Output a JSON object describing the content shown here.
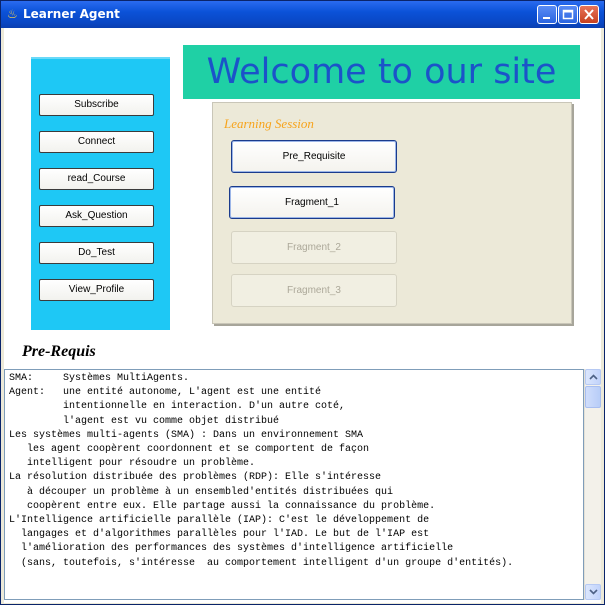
{
  "window": {
    "title": "Learner Agent",
    "icon": "java-cup-icon",
    "controls": [
      "minimize",
      "maximize",
      "close"
    ]
  },
  "sidebar": {
    "color": "#1ec8f5",
    "items": [
      {
        "label": "Subscribe"
      },
      {
        "label": "Connect"
      },
      {
        "label": "read_Course"
      },
      {
        "label": "Ask_Question"
      },
      {
        "label": "Do_Test"
      },
      {
        "label": "View_Profile"
      }
    ]
  },
  "banner": {
    "text": "Welcome to our site",
    "background": "#1fd0a5",
    "color": "#1b53c9"
  },
  "session": {
    "label": "Learning Session",
    "buttons": [
      {
        "label": "Pre_Requisite",
        "enabled": true
      },
      {
        "label": "Fragment_1",
        "enabled": true
      },
      {
        "label": "Fragment_2",
        "enabled": false
      },
      {
        "label": "Fragment_3",
        "enabled": false
      }
    ]
  },
  "content": {
    "heading": "Pre-Requis",
    "lines": [
      "SMA:     Systèmes MultiAgents.",
      "Agent:   une entité autonome, L'agent est une entité",
      "         intentionnelle en interaction. D'un autre coté,",
      "         l'agent est vu comme objet distribué",
      "Les systèmes multi-agents (SMA) : Dans un environnement SMA",
      "   les agent coopèrent coordonnent et se comportent de façon",
      "   intelligent pour résoudre un problème.",
      "La résolution distribuée des problèmes (RDP): Elle s'intéresse",
      "   à découper un problème à un ensembled'entités distribuées qui",
      "   coopèrent entre eux. Elle partage aussi la connaissance du problème.",
      "L'Intelligence artificielle parallèle (IAP): C'est le développement de",
      "  langages et d'algorithmes parallèles pour l'IAD. Le but de l'IAP est",
      "  l'amélioration des performances des systèmes d'intelligence artificielle",
      "  (sans, toutefois, s'intéresse  au comportement intelligent d'un groupe d'entités)."
    ]
  }
}
